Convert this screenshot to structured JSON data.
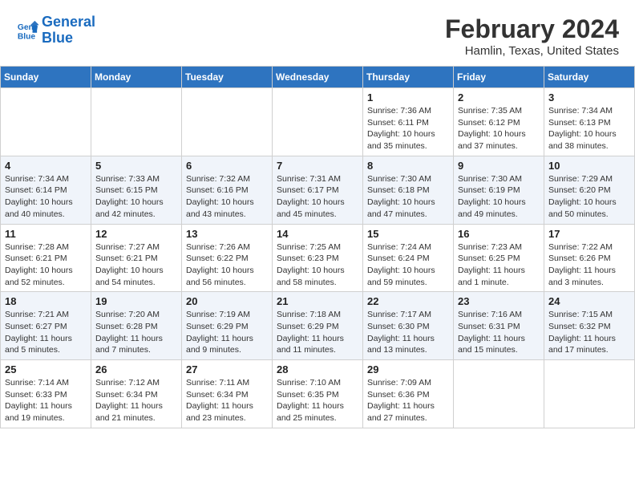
{
  "header": {
    "logo_line1": "General",
    "logo_line2": "Blue",
    "title": "February 2024",
    "subtitle": "Hamlin, Texas, United States"
  },
  "weekdays": [
    "Sunday",
    "Monday",
    "Tuesday",
    "Wednesday",
    "Thursday",
    "Friday",
    "Saturday"
  ],
  "weeks": [
    [
      {
        "day": "",
        "info": ""
      },
      {
        "day": "",
        "info": ""
      },
      {
        "day": "",
        "info": ""
      },
      {
        "day": "",
        "info": ""
      },
      {
        "day": "1",
        "info": "Sunrise: 7:36 AM\nSunset: 6:11 PM\nDaylight: 10 hours\nand 35 minutes."
      },
      {
        "day": "2",
        "info": "Sunrise: 7:35 AM\nSunset: 6:12 PM\nDaylight: 10 hours\nand 37 minutes."
      },
      {
        "day": "3",
        "info": "Sunrise: 7:34 AM\nSunset: 6:13 PM\nDaylight: 10 hours\nand 38 minutes."
      }
    ],
    [
      {
        "day": "4",
        "info": "Sunrise: 7:34 AM\nSunset: 6:14 PM\nDaylight: 10 hours\nand 40 minutes."
      },
      {
        "day": "5",
        "info": "Sunrise: 7:33 AM\nSunset: 6:15 PM\nDaylight: 10 hours\nand 42 minutes."
      },
      {
        "day": "6",
        "info": "Sunrise: 7:32 AM\nSunset: 6:16 PM\nDaylight: 10 hours\nand 43 minutes."
      },
      {
        "day": "7",
        "info": "Sunrise: 7:31 AM\nSunset: 6:17 PM\nDaylight: 10 hours\nand 45 minutes."
      },
      {
        "day": "8",
        "info": "Sunrise: 7:30 AM\nSunset: 6:18 PM\nDaylight: 10 hours\nand 47 minutes."
      },
      {
        "day": "9",
        "info": "Sunrise: 7:30 AM\nSunset: 6:19 PM\nDaylight: 10 hours\nand 49 minutes."
      },
      {
        "day": "10",
        "info": "Sunrise: 7:29 AM\nSunset: 6:20 PM\nDaylight: 10 hours\nand 50 minutes."
      }
    ],
    [
      {
        "day": "11",
        "info": "Sunrise: 7:28 AM\nSunset: 6:21 PM\nDaylight: 10 hours\nand 52 minutes."
      },
      {
        "day": "12",
        "info": "Sunrise: 7:27 AM\nSunset: 6:21 PM\nDaylight: 10 hours\nand 54 minutes."
      },
      {
        "day": "13",
        "info": "Sunrise: 7:26 AM\nSunset: 6:22 PM\nDaylight: 10 hours\nand 56 minutes."
      },
      {
        "day": "14",
        "info": "Sunrise: 7:25 AM\nSunset: 6:23 PM\nDaylight: 10 hours\nand 58 minutes."
      },
      {
        "day": "15",
        "info": "Sunrise: 7:24 AM\nSunset: 6:24 PM\nDaylight: 10 hours\nand 59 minutes."
      },
      {
        "day": "16",
        "info": "Sunrise: 7:23 AM\nSunset: 6:25 PM\nDaylight: 11 hours\nand 1 minute."
      },
      {
        "day": "17",
        "info": "Sunrise: 7:22 AM\nSunset: 6:26 PM\nDaylight: 11 hours\nand 3 minutes."
      }
    ],
    [
      {
        "day": "18",
        "info": "Sunrise: 7:21 AM\nSunset: 6:27 PM\nDaylight: 11 hours\nand 5 minutes."
      },
      {
        "day": "19",
        "info": "Sunrise: 7:20 AM\nSunset: 6:28 PM\nDaylight: 11 hours\nand 7 minutes."
      },
      {
        "day": "20",
        "info": "Sunrise: 7:19 AM\nSunset: 6:29 PM\nDaylight: 11 hours\nand 9 minutes."
      },
      {
        "day": "21",
        "info": "Sunrise: 7:18 AM\nSunset: 6:29 PM\nDaylight: 11 hours\nand 11 minutes."
      },
      {
        "day": "22",
        "info": "Sunrise: 7:17 AM\nSunset: 6:30 PM\nDaylight: 11 hours\nand 13 minutes."
      },
      {
        "day": "23",
        "info": "Sunrise: 7:16 AM\nSunset: 6:31 PM\nDaylight: 11 hours\nand 15 minutes."
      },
      {
        "day": "24",
        "info": "Sunrise: 7:15 AM\nSunset: 6:32 PM\nDaylight: 11 hours\nand 17 minutes."
      }
    ],
    [
      {
        "day": "25",
        "info": "Sunrise: 7:14 AM\nSunset: 6:33 PM\nDaylight: 11 hours\nand 19 minutes."
      },
      {
        "day": "26",
        "info": "Sunrise: 7:12 AM\nSunset: 6:34 PM\nDaylight: 11 hours\nand 21 minutes."
      },
      {
        "day": "27",
        "info": "Sunrise: 7:11 AM\nSunset: 6:34 PM\nDaylight: 11 hours\nand 23 minutes."
      },
      {
        "day": "28",
        "info": "Sunrise: 7:10 AM\nSunset: 6:35 PM\nDaylight: 11 hours\nand 25 minutes."
      },
      {
        "day": "29",
        "info": "Sunrise: 7:09 AM\nSunset: 6:36 PM\nDaylight: 11 hours\nand 27 minutes."
      },
      {
        "day": "",
        "info": ""
      },
      {
        "day": "",
        "info": ""
      }
    ]
  ]
}
